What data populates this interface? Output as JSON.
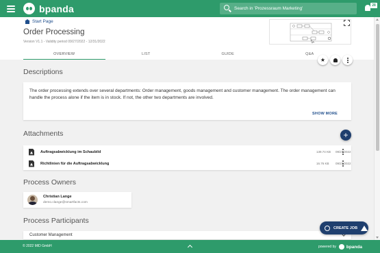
{
  "topbar": {
    "brand": "bpanda",
    "search_placeholder": "Search in 'Prozessraum Marketing'",
    "notification_count": "28"
  },
  "header": {
    "breadcrumb": "Start Page",
    "title": "Order Processing",
    "version": "Version V1.1 - Validity period 09/27/2022 - 12/31/2022",
    "tabs": [
      {
        "label": "OVERVIEW",
        "active": true
      },
      {
        "label": "LIST",
        "active": false
      },
      {
        "label": "GUIDE",
        "active": false
      },
      {
        "label": "Q&A",
        "active": false
      }
    ]
  },
  "descriptions": {
    "title": "Descriptions",
    "text": "The order processing extends over several departments: Order management, goods management and customer management. The order management can handle the process alone if the item is in stock. If not, the other two departments are involved.",
    "show_more": "SHOW MORE"
  },
  "attachments": {
    "title": "Attachments",
    "items": [
      {
        "name": "Auftragsabwicklung im Schaubild",
        "size": "139.74 KB",
        "date": "09/27/2022"
      },
      {
        "name": "Richtlinien für die Auftragsabwicklung",
        "size": "16.76 KB",
        "date": "09/27/2022"
      }
    ]
  },
  "process_owners": {
    "title": "Process Owners",
    "owner": {
      "name": "Christian Lange",
      "email": "demo.clange@smartfacts.com"
    }
  },
  "process_participants": {
    "title": "Process Participants",
    "first_group": "Customer Management"
  },
  "create_job": "CREATE JOB",
  "footer": {
    "copyright": "© 2022 MID GmbH",
    "powered_by": "powered by",
    "brand": "bpanda"
  },
  "colors": {
    "brand_green": "#2e9b6b",
    "navy": "#1f3f6e",
    "link_blue": "#1f4e8c"
  }
}
